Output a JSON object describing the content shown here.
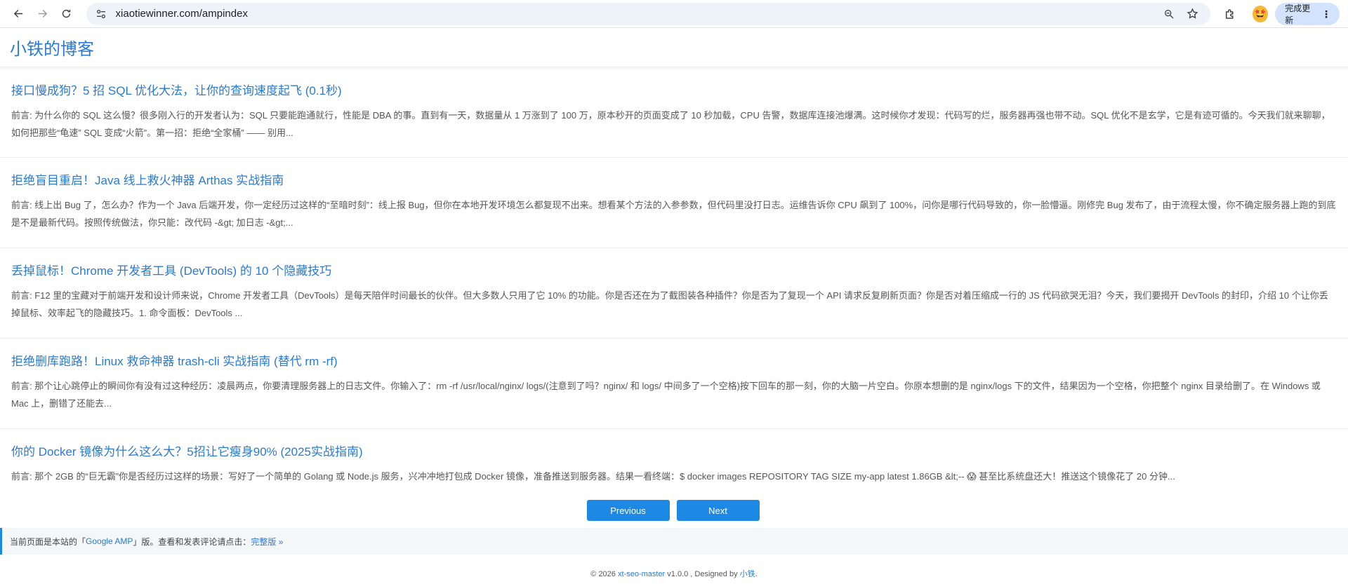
{
  "browser": {
    "url": "xiaotiewinner.com/ampindex",
    "update_label": "完成更新",
    "profile_emoji": "🤩"
  },
  "site": {
    "title": "小铁的博客"
  },
  "posts": [
    {
      "title": "接口慢成狗？5 招 SQL 优化大法，让你的查询速度起飞 (0.1秒)",
      "excerpt": "前言: 为什么你的 SQL 这么慢？很多刚入行的开发者认为：SQL 只要能跑通就行，性能是 DBA 的事。直到有一天，数据量从 1 万涨到了 100 万，原本秒开的页面变成了 10 秒加载，CPU 告警，数据库连接池爆满。这时候你才发现：代码写的烂，服务器再强也带不动。SQL 优化不是玄学，它是有迹可循的。今天我们就来聊聊，如何把那些“龟速” SQL 变成“火箭”。第一招：拒绝“全家桶” —— 别用..."
    },
    {
      "title": "拒绝盲目重启！Java 线上救火神器 Arthas 实战指南",
      "excerpt": "前言: 线上出 Bug 了，怎么办？作为一个 Java 后端开发，你一定经历过这样的“至暗时刻”：线上报 Bug，但你在本地开发环境怎么都复现不出来。想看某个方法的入参参数，但代码里没打日志。运维告诉你 CPU 飙到了 100%，问你是哪行代码导致的，你一脸懵逼。刚修完 Bug 发布了，由于流程太慢，你不确定服务器上跑的到底是不是最新代码。按照传统做法，你只能：改代码 -&gt; 加日志 -&gt;..."
    },
    {
      "title": "丢掉鼠标！Chrome 开发者工具 (DevTools) 的 10 个隐藏技巧",
      "excerpt": "前言: F12 里的宝藏对于前端开发和设计师来说，Chrome 开发者工具（DevTools）是每天陪伴时间最长的伙伴。但大多数人只用了它 10% 的功能。你是否还在为了截图装各种插件？你是否为了复现一个 API 请求反复刷新页面？你是否对着压缩成一行的 JS 代码欲哭无泪？今天，我们要揭开 DevTools 的封印，介绍 10 个让你丢掉鼠标、效率起飞的隐藏技巧。1. 命令面板：DevTools ..."
    },
    {
      "title": "拒绝删库跑路！Linux 救命神器 trash-cli 实战指南 (替代 rm -rf)",
      "excerpt": "前言: 那个让心跳停止的瞬间你有没有过这种经历：凌晨两点，你要清理服务器上的日志文件。你输入了：rm -rf /usr/local/nginx/ logs/(注意到了吗？nginx/ 和 logs/ 中间多了一个空格)按下回车的那一刻，你的大脑一片空白。你原本想删的是 nginx/logs 下的文件，结果因为一个空格，你把整个 nginx 目录给删了。在 Windows 或 Mac 上，删错了还能去..."
    },
    {
      "title": "你的 Docker 镜像为什么这么大？5招让它瘦身90% (2025实战指南)",
      "excerpt": "前言: 那个 2GB 的“巨无霸”你是否经历过这样的场景：写好了一个简单的 Golang 或 Node.js 服务，兴冲冲地打包成 Docker 镜像，准备推送到服务器。结果一看终端：$ docker images REPOSITORY TAG SIZE my-app latest 1.86GB &lt;-- 😱 甚至比系统盘还大！推送这个镜像花了 20 分钟..."
    }
  ],
  "pagination": {
    "prev_label": "Previous",
    "next_label": "Next"
  },
  "amp_notice": {
    "prefix": "当前页面是本站的「",
    "amp_link": "Google AMP",
    "middle": "」版。查看和发表评论请点击：",
    "full_link": "完整版 »"
  },
  "footer": {
    "copyright": "© 2026 ",
    "project_link": "xt-seo-master",
    "version": " v1.0.0 , Designed by ",
    "author_link": "小铁",
    "end": "."
  }
}
